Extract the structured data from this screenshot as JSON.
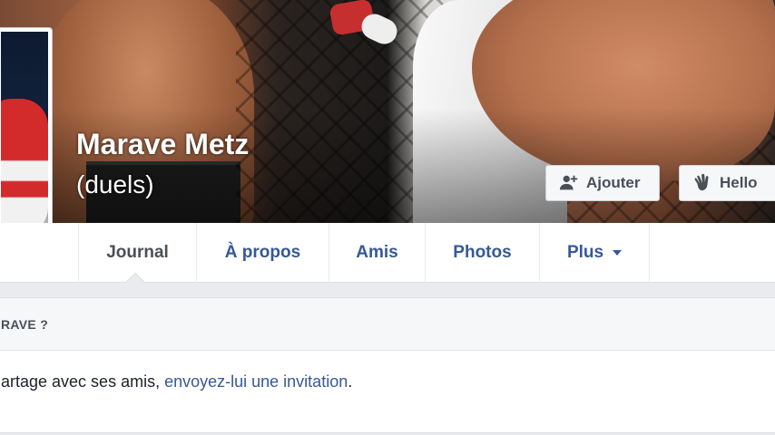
{
  "profile": {
    "name": "Marave Metz",
    "subname": "(duels)"
  },
  "cover_buttons": {
    "add_label": "Ajouter",
    "add_icon": "add-friend-icon",
    "hello_label": "Hello",
    "hello_icon": "wave-hand-icon"
  },
  "tabs": [
    {
      "label": "Journal",
      "active": true
    },
    {
      "label": "À propos"
    },
    {
      "label": "Amis"
    },
    {
      "label": "Photos"
    },
    {
      "label": "Plus",
      "icon": "caret-down-icon"
    }
  ],
  "card": {
    "header": "RAVE ?",
    "body_text": "artage avec ses amis, ",
    "link_text": "envoyez-lui une invitation",
    "body_end": "."
  },
  "colors": {
    "link": "#365899",
    "background": "#e9ebee",
    "text": "#4b4f56"
  }
}
